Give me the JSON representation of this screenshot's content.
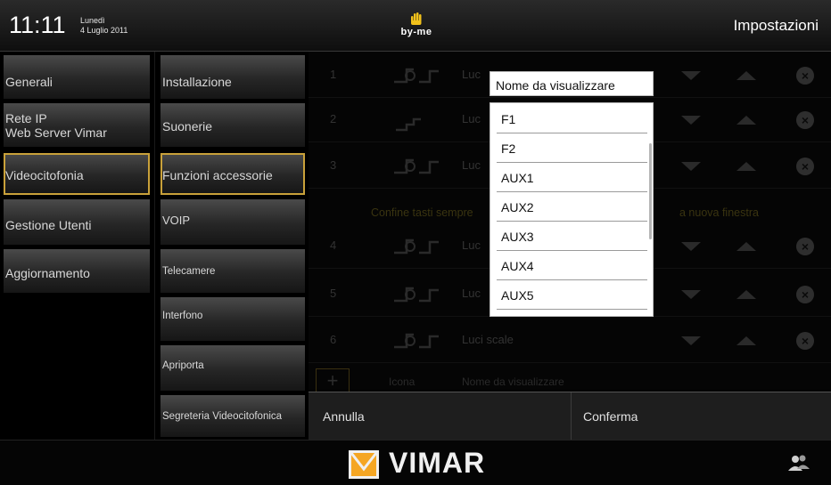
{
  "header": {
    "time": "11:11",
    "day": "Lunedì",
    "date": "4 Luglio 2011",
    "brand": "by-me",
    "title": "Impostazioni"
  },
  "menu_primary": [
    {
      "label": "Generali"
    },
    {
      "label": "Rete IP\nWeb Server Vimar"
    },
    {
      "label": "Videocitofonia",
      "selected": true
    },
    {
      "label": "Gestione Utenti"
    },
    {
      "label": "Aggiornamento"
    }
  ],
  "menu_secondary": [
    {
      "label": "Installazione"
    },
    {
      "label": "Suonerie"
    },
    {
      "label": "Funzioni accessorie",
      "selected": true
    },
    {
      "label": "VOIP"
    },
    {
      "label": "Telecamere"
    },
    {
      "label": "Interfono"
    },
    {
      "label": "Apriporta"
    },
    {
      "label": "Segreteria Videocitofonica"
    }
  ],
  "list_rows": [
    {
      "num": "1",
      "text": "Luc"
    },
    {
      "num": "2",
      "text": "Luc"
    },
    {
      "num": "3",
      "text": "Luc"
    },
    {
      "num": "4",
      "text": "Luc"
    },
    {
      "num": "5",
      "text": "Luc"
    },
    {
      "num": "6",
      "text": "Luci scale"
    }
  ],
  "note_left": "Confine tasti sempre",
  "note_right": "a nuova finestra",
  "add_row": {
    "plus": "+",
    "icon_label": "Icona",
    "name_label": "Nome da visualizzare"
  },
  "dialog": {
    "field_label": "Nome da visualizzare",
    "options": [
      "F1",
      "F2",
      "AUX1",
      "AUX2",
      "AUX3",
      "AUX4",
      "AUX5"
    ],
    "cancel": "Annulla",
    "confirm": "Conferma"
  },
  "footer": {
    "brand": "VIMAR"
  },
  "colors": {
    "selected_outline": "#c9a13a",
    "background": "#000000"
  }
}
